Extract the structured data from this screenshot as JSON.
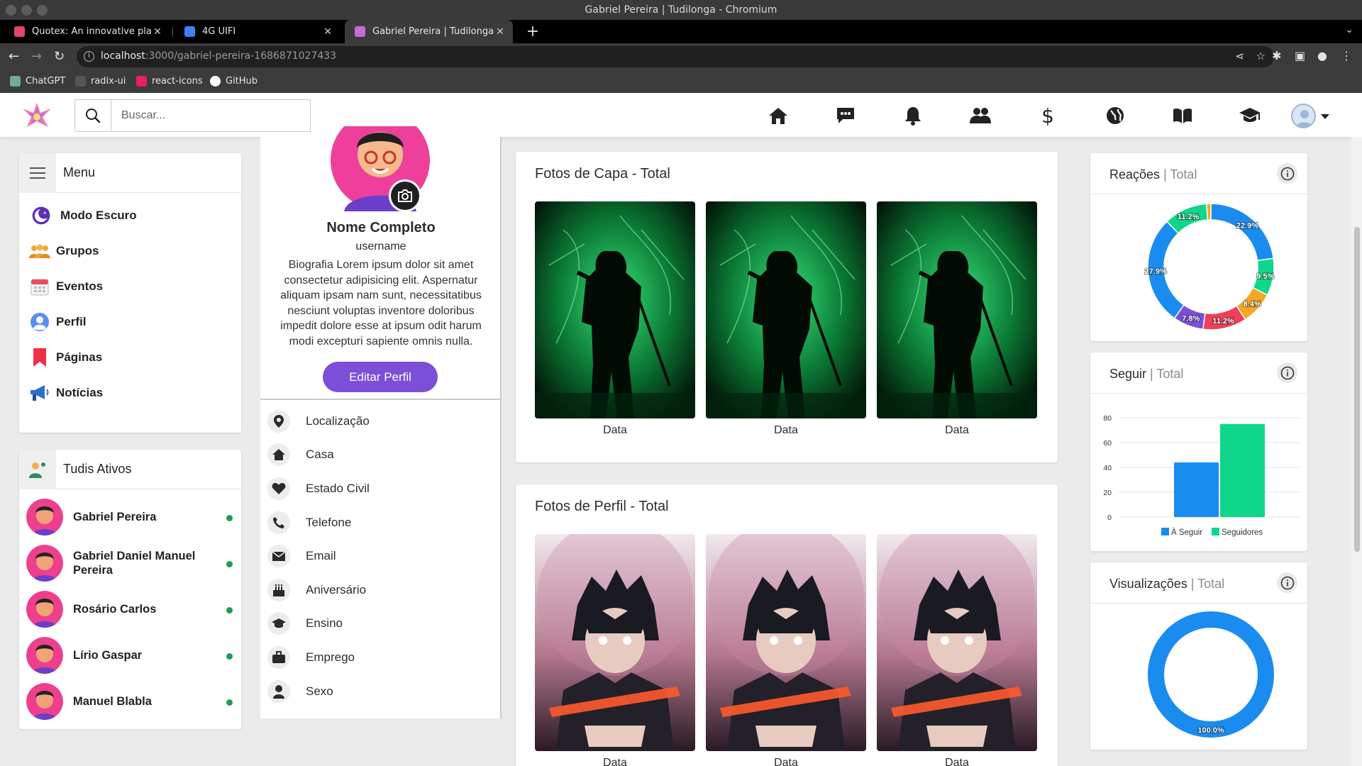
{
  "window": {
    "title": "Gabriel Pereira | Tudilonga - Chromium"
  },
  "tabs": [
    {
      "label": "Quotex: An innovative platfo",
      "color": "#e0456b"
    },
    {
      "label": "4G UIFI",
      "color": "#3b82f6"
    },
    {
      "label": "Gabriel Pereira | Tudilonga",
      "color": "#c86ad8"
    }
  ],
  "address": {
    "host": "localhost",
    "path": ":3000/gabriel-pereira-1686871027433"
  },
  "bookmarks": [
    {
      "label": "ChatGPT",
      "color": "#74aa9c"
    },
    {
      "label": "radix-ui",
      "color": "#555555"
    },
    {
      "label": "react-icons",
      "color": "#e91e63"
    },
    {
      "label": "GitHub",
      "color": "#ffffff"
    }
  ],
  "header": {
    "search_placeholder": "Buscar...",
    "nav_icons": [
      "home-icon",
      "chat-icon",
      "bell-icon",
      "users-icon",
      "dollar-icon",
      "globe-icon",
      "book-icon",
      "graduation-cap-icon"
    ]
  },
  "menu": {
    "title": "Menu",
    "items": [
      {
        "label": "Modo Escuro",
        "icon": "moon-icon"
      },
      {
        "label": "Grupos",
        "icon": "groups-icon"
      },
      {
        "label": "Eventos",
        "icon": "calendar-icon"
      },
      {
        "label": "Perfil",
        "icon": "user-icon"
      },
      {
        "label": "Páginas",
        "icon": "bookmark-icon"
      },
      {
        "label": "Notícias",
        "icon": "megaphone-icon"
      }
    ]
  },
  "active": {
    "title": "Tudis Ativos",
    "users": [
      {
        "name": "Gabriel Pereira"
      },
      {
        "name": "Gabriel Daniel Manuel Pereira"
      },
      {
        "name": "Rosário Carlos"
      },
      {
        "name": "Lírio Gaspar"
      },
      {
        "name": "Manuel Blabla"
      }
    ]
  },
  "profile": {
    "name": "Nome Completo",
    "username": "username",
    "bio": "Biografia Lorem ipsum dolor sit amet consectetur adipisicing elit. Aspernatur aliquam ipsam nam sunt, necessitatibus nesciunt voluptas inventore doloribus impedit dolore esse at ipsum odit harum modi excepturi sapiente omnis nulla.",
    "edit_label": "Editar Perfil",
    "info": [
      {
        "label": "Localização",
        "icon": "map-pin-icon"
      },
      {
        "label": "Casa",
        "icon": "house-icon"
      },
      {
        "label": "Estado Civil",
        "icon": "heart-icon"
      },
      {
        "label": "Telefone",
        "icon": "phone-icon"
      },
      {
        "label": "Email",
        "icon": "mail-icon"
      },
      {
        "label": "Aniversário",
        "icon": "cake-icon"
      },
      {
        "label": "Ensino",
        "icon": "graduation-cap-icon"
      },
      {
        "label": "Emprego",
        "icon": "briefcase-icon"
      },
      {
        "label": "Sexo",
        "icon": "person-icon"
      }
    ]
  },
  "cover_photos": {
    "title": "Fotos de Capa - Total",
    "captions": [
      "Data",
      "Data",
      "Data"
    ]
  },
  "profile_photos": {
    "title": "Fotos de Perfil - Total",
    "captions": [
      "Data",
      "Data",
      "Data"
    ]
  },
  "stats": {
    "reactions": {
      "title": "Reações",
      "subtitle": "Total"
    },
    "follow": {
      "title": "Seguir",
      "subtitle": "Total"
    },
    "views": {
      "title": "Visualizações",
      "subtitle": "Total"
    }
  },
  "chart_data": [
    {
      "type": "pie",
      "title": "Reações",
      "labels": [
        "22.9%",
        "9.5%",
        "8.4%",
        "11.2%",
        "7.8%",
        "27.9%",
        "11.2%",
        "1.1%"
      ],
      "values": [
        22.9,
        9.5,
        8.4,
        11.2,
        7.8,
        27.9,
        11.2,
        1.1
      ],
      "colors": [
        "#1a8cf0",
        "#0fd68a",
        "#f5a623",
        "#ef3f5a",
        "#7a4fd8",
        "#1a8cf0",
        "#0fd68a",
        "#f5a623"
      ],
      "donut": true
    },
    {
      "type": "bar",
      "title": "Seguir",
      "categories": [
        ""
      ],
      "series": [
        {
          "name": "À Seguir",
          "values": [
            44
          ],
          "color": "#1a8cf0"
        },
        {
          "name": "Seguidores",
          "values": [
            75
          ],
          "color": "#0fd68a"
        }
      ],
      "ylim": [
        0,
        80
      ],
      "yticks": [
        0,
        20,
        40,
        60,
        80
      ],
      "grid": true,
      "legend": "bottom"
    },
    {
      "type": "pie",
      "title": "Visualizações",
      "labels": [
        "100.0%"
      ],
      "values": [
        100
      ],
      "colors": [
        "#1a8cf0"
      ],
      "donut": true
    }
  ]
}
